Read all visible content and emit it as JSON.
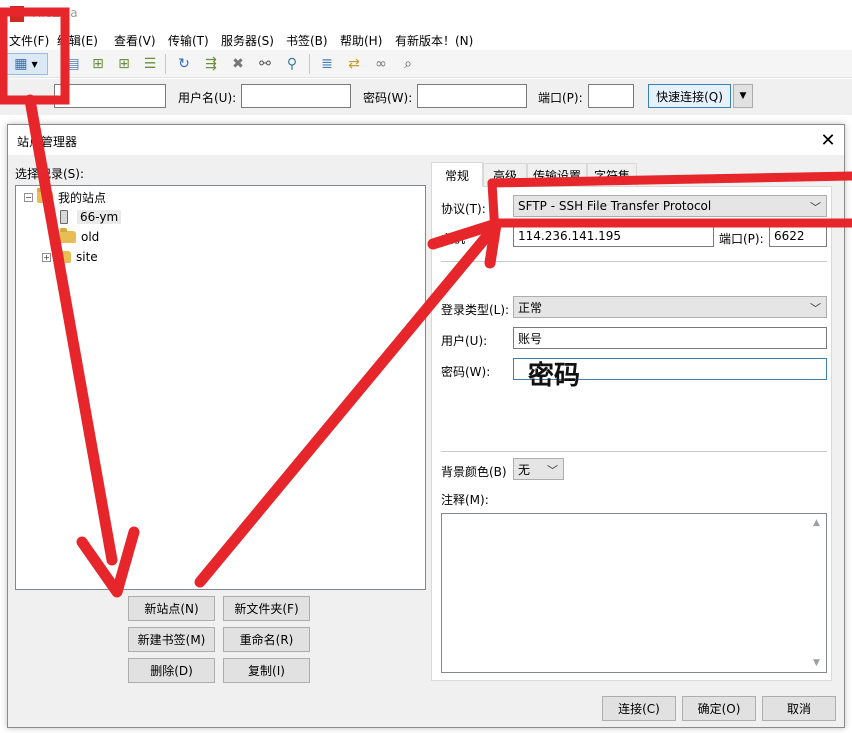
{
  "app": {
    "logo": "Z",
    "title": "FileZilla"
  },
  "menu": {
    "items": [
      "文件(F)",
      "编辑(E)",
      "查看(V)",
      "传输(T)",
      "服务器(S)",
      "书签(B)",
      "帮助(H)",
      "有新版本！(N)"
    ]
  },
  "toolbar": {
    "icons": [
      "site-manager-icon",
      "toggle-log-icon",
      "toggle-local-tree-icon",
      "toggle-remote-tree-icon",
      "toggle-queue-icon",
      "refresh-icon",
      "process-queue-icon",
      "cancel-icon",
      "disconnect-icon",
      "reconnect-icon",
      "directory-filter-icon",
      "compare-dirs-icon",
      "sync-browsing-icon",
      "search-icon"
    ]
  },
  "quickconnect": {
    "username_label": "用户名(U):",
    "password_label": "密码(W):",
    "port_label": "端口(P):",
    "connect_label": "快速连接(Q)"
  },
  "dialog": {
    "title": "站点管理器",
    "select_label": "选择记录(S):",
    "tree": {
      "root": "我的站点",
      "items": [
        "66-ym",
        "old",
        "site"
      ]
    },
    "buttons": {
      "new_site": "新站点(N)",
      "new_folder": "新文件夹(F)",
      "new_bookmark": "新建书签(M)",
      "rename": "重命名(R)",
      "delete": "删除(D)",
      "copy": "复制(I)",
      "connect": "连接(C)",
      "ok": "确定(O)",
      "cancel": "取消"
    },
    "tabs": [
      "常规",
      "高级",
      "传输设置",
      "字符集"
    ],
    "general": {
      "protocol_label": "协议(T):",
      "protocol_value": "SFTP - SSH File Transfer Protocol",
      "host_label": "主机",
      "host_value": "114.236.141.195",
      "port_label": "端口(P):",
      "port_value": "6622",
      "logon_type_label": "登录类型(L):",
      "logon_type_value": "正常",
      "user_label": "用户(U):",
      "user_value": "账号",
      "password_label": "密码(W):",
      "password_value": "密码",
      "bgcolor_label": "背景颜色(B)",
      "bgcolor_value": "无",
      "comments_label": "注释(M):"
    }
  },
  "colors": {
    "annotation_red": "#e6262b",
    "button_focus_border": "#3c7fb1",
    "folder_yellow": "#e8bd53"
  }
}
